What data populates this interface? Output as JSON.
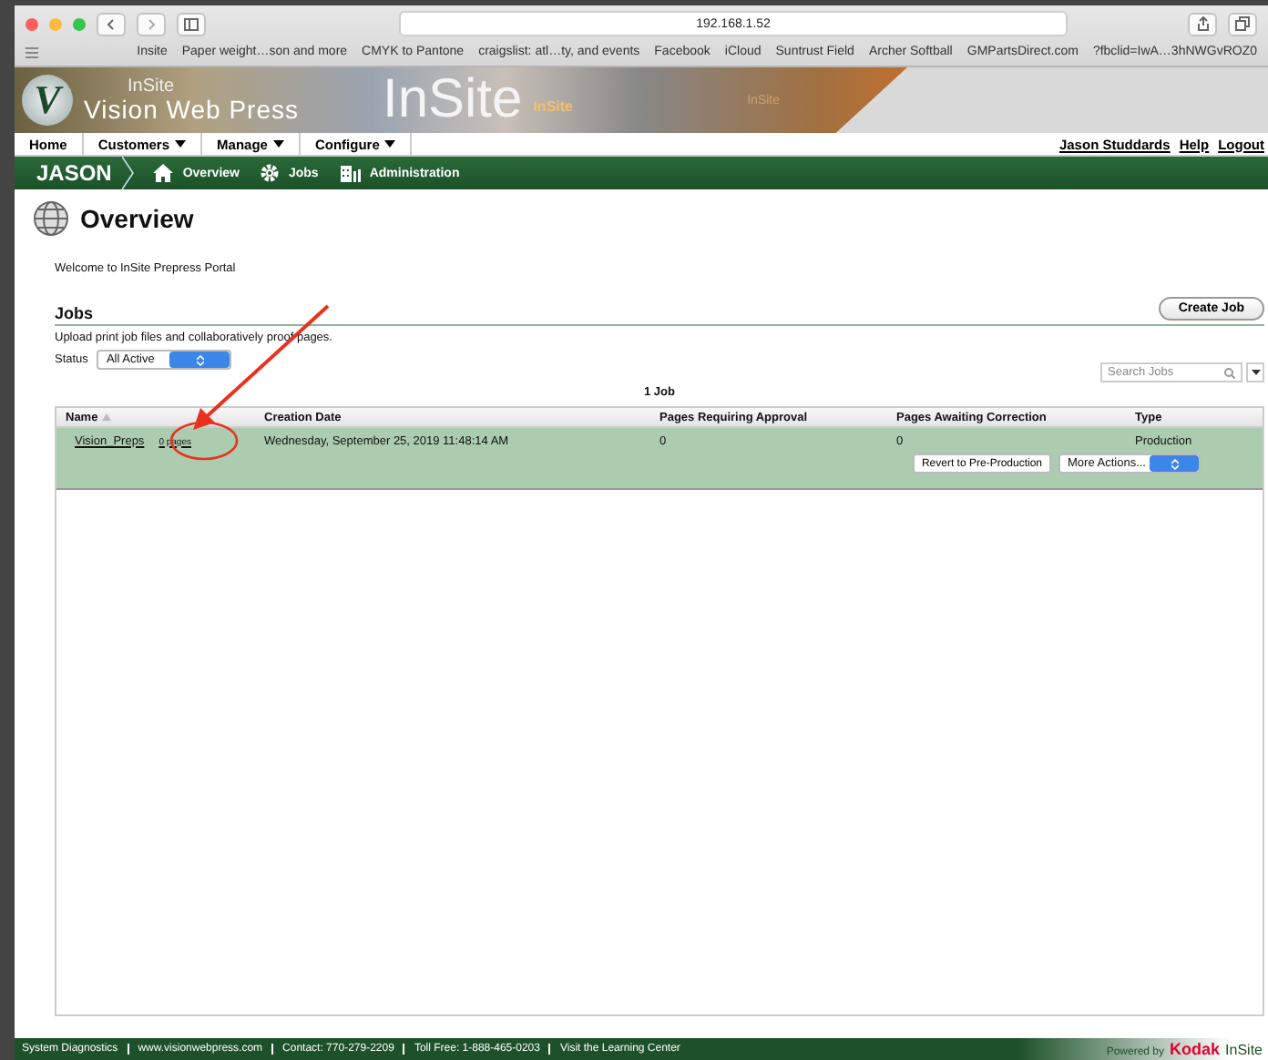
{
  "browser": {
    "url": "192.168.1.52",
    "bookmarks": [
      "Insite",
      "Paper weight…son and more",
      "CMYK to Pantone",
      "craigslist: atl…ty, and events",
      "Facebook",
      "iCloud",
      "Suntrust Field",
      "Archer Softball",
      "GMPartsDirect.com",
      "?fbclid=IwA…3hNWGvROZ0"
    ]
  },
  "banner": {
    "logo_letter": "V",
    "brand_small": "InSite",
    "brand": "Vision Web Press",
    "product": "InSite",
    "product_tag": "InSite",
    "product_small": "InSite"
  },
  "menu": [
    {
      "label": "Home",
      "dropdown": false
    },
    {
      "label": "Customers",
      "dropdown": true
    },
    {
      "label": "Manage",
      "dropdown": true
    },
    {
      "label": "Configure",
      "dropdown": true
    }
  ],
  "user_links": [
    "Jason Studdards",
    "Help",
    "Logout"
  ],
  "nav": {
    "user": "JASON",
    "items": [
      {
        "label": "Overview"
      },
      {
        "label": "Jobs"
      },
      {
        "label": "Administration"
      }
    ]
  },
  "page": {
    "title": "Overview",
    "welcome": "Welcome to InSite Prepress Portal",
    "section": "Jobs",
    "description": "Upload print job files and collaboratively proof pages.",
    "status_label": "Status",
    "status_value": "All Active",
    "create_button": "Create Job",
    "search_placeholder": "Search Jobs",
    "job_count": "1 Job"
  },
  "table": {
    "columns": [
      "Name",
      "Creation Date",
      "Pages Requiring Approval",
      "Pages Awaiting Correction",
      "Type"
    ],
    "rows": [
      {
        "name": "Vision_Preps",
        "pages": "0 pages",
        "date": "Wednesday, September 25, 2019 11:48:14 AM",
        "approval": "0",
        "correction": "0",
        "type": "Production",
        "selected": true,
        "action_button": "Revert to Pre-Production",
        "action_menu": "More Actions..."
      }
    ]
  },
  "footer": {
    "links": [
      "System Diagnostics",
      "www.visionwebpress.com",
      "Contact: 770-279-2209",
      "Toll Free: 1-888-465-0203",
      "Visit the Learning Center"
    ],
    "powered_by": "Powered by",
    "brand": "Kodak",
    "product": "InSite"
  }
}
